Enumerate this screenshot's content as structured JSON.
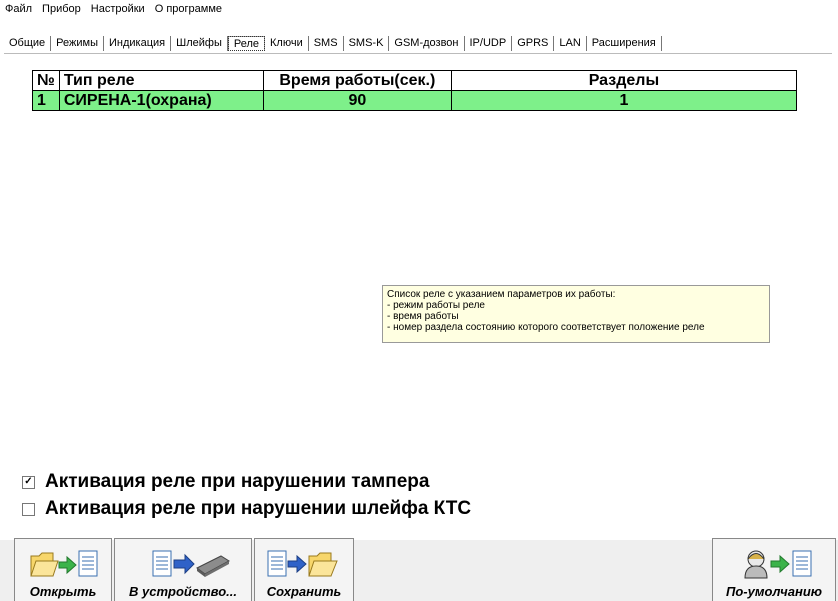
{
  "menu": [
    "Файл",
    "Прибор",
    "Настройки",
    "О программе"
  ],
  "tabs": [
    "Общие",
    "Режимы",
    "Индикация",
    "Шлейфы",
    "Реле",
    "Ключи",
    "SMS",
    "SMS-K",
    "GSM-дозвон",
    "IP/UDP",
    "GPRS",
    "LAN",
    "Расширения"
  ],
  "active_tab": "Реле",
  "table": {
    "headers": [
      "№",
      "Тип реле",
      "Время работы(сек.)",
      "Разделы"
    ],
    "rows": [
      {
        "n": "1",
        "type": "СИРЕНА-1(охрана)",
        "time": "90",
        "sections": "1"
      }
    ]
  },
  "tooltip": {
    "line1": "Список реле с указанием параметров их работы:",
    "line2": "- режим работы реле",
    "line3": "- время работы",
    "line4": "- номер раздела состоянию которого соответствует положение реле"
  },
  "checkboxes": [
    {
      "label": "Активация реле при нарушении тампера",
      "checked": true
    },
    {
      "label": "Активация реле при нарушении шлейфа КТС",
      "checked": false
    }
  ],
  "toolbar": {
    "open": "Открыть",
    "to_device": "В устройство...",
    "save": "Сохранить",
    "defaults": "По-умолчанию"
  },
  "colors": {
    "selected_row": "#7ef08a",
    "tooltip_bg": "#ffffe1"
  }
}
